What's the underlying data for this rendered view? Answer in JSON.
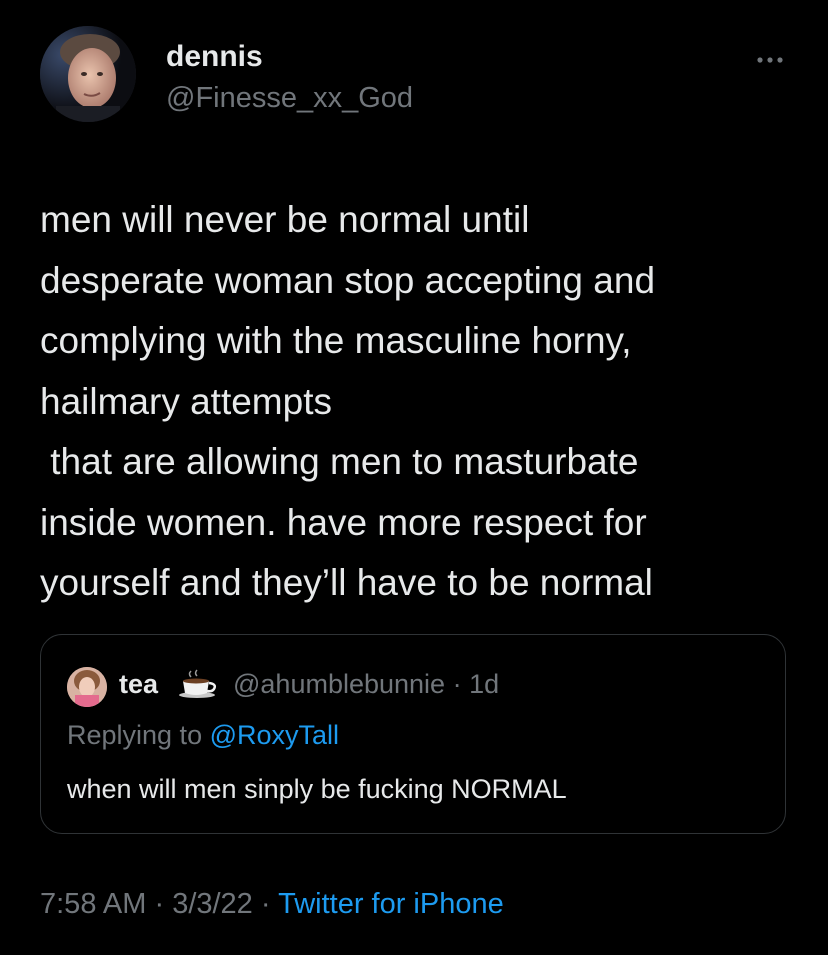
{
  "tweet": {
    "author": {
      "display_name": "dennis",
      "handle": "@Finesse_xx_God",
      "avatar_icon": "profile-photo"
    },
    "more_icon": "more-options-icon",
    "text": "men will never be normal until\ndesperate woman stop accepting and\ncomplying with the masculine horny,\nhailmary attempts\n that are allowing men to masturbate\ninside women. have more respect for\nyourself and they’ll have to be normal",
    "quote": {
      "display_name": "tea",
      "name_emoji": "hot-beverage-emoji",
      "handle": "@ahumblebunnie",
      "separator": " · ",
      "age": "1d",
      "replying_prefix": "Replying to ",
      "replying_to": "@RoxyTall",
      "text": "when will men sinply be fucking NORMAL"
    },
    "footer": {
      "time": "7:58 AM",
      "date": "3/3/22",
      "separator": " · ",
      "source": "Twitter for iPhone"
    }
  },
  "colors": {
    "background": "#000000",
    "primary_text": "#e7e9ea",
    "secondary_text": "#71767b",
    "link": "#1d9bf0",
    "border": "#2f3336"
  }
}
